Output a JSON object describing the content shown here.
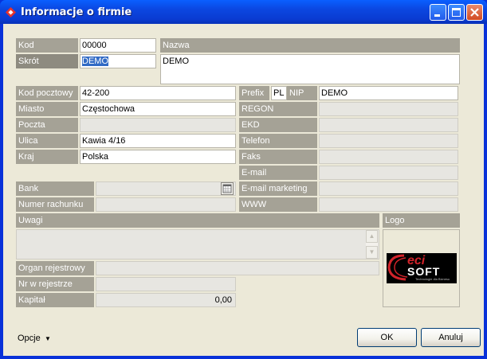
{
  "window": {
    "title": "Informacje o firmie"
  },
  "labels": {
    "kod": "Kod",
    "skrot": "Skrót",
    "nazwa": "Nazwa",
    "kod_pocztowy": "Kod pocztowy",
    "miasto": "Miasto",
    "poczta": "Poczta",
    "ulica": "Ulica",
    "kraj": "Kraj",
    "prefix": "Prefix",
    "nip": "NIP",
    "regon": "REGON",
    "ekd": "EKD",
    "telefon": "Telefon",
    "faks": "Faks",
    "email": "E-mail",
    "email_marketing": "E-mail marketing",
    "www": "WWW",
    "bank": "Bank",
    "numer_rachunku": "Numer rachunku",
    "uwagi": "Uwagi",
    "logo": "Logo",
    "organ": "Organ rejestrowy",
    "nr_rejestr": "Nr w rejestrze",
    "kapital": "Kapitał"
  },
  "values": {
    "kod": "00000",
    "skrot": "DEMO",
    "nazwa": "DEMO",
    "kod_pocztowy": "42-200",
    "miasto": "Częstochowa",
    "poczta": "",
    "ulica": "Kawia 4/16",
    "kraj": "Polska",
    "prefix": "PL",
    "nip": "DEMO",
    "kapital": "0,00"
  },
  "logo": {
    "brand_top": "eci",
    "brand_bottom": "SOFT",
    "tagline": "Technologie dla Biznesu"
  },
  "buttons": {
    "opcje": "Opcje",
    "ok": "OK",
    "anuluj": "Anuluj"
  },
  "colors": {
    "title_blue": "#0a3bd1",
    "label_bg": "#a5a296",
    "selection": "#316ac5",
    "logo_red": "#d2232a"
  }
}
